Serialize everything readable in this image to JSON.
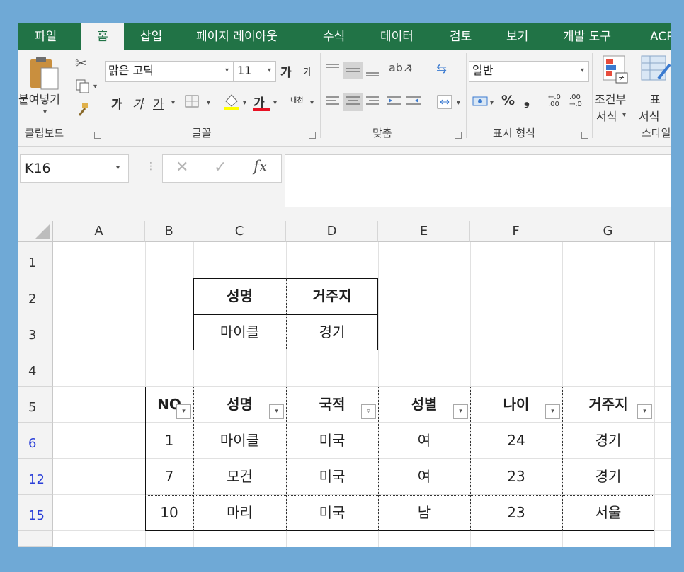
{
  "tabs": [
    "파일",
    "홈",
    "삽입",
    "페이지 레이아웃",
    "수식",
    "데이터",
    "검토",
    "보기",
    "개발 도구",
    "ACR"
  ],
  "ribbon": {
    "paste_label": "붙여넣기",
    "font_name": "맑은 고딕",
    "font_size": "11",
    "grow_font": "가",
    "shrink_font": "가",
    "bold": "가",
    "italic": "가",
    "underline": "가",
    "font_color_glyph": "가",
    "phonetic": "내천",
    "number_format": "일반",
    "percent": "%",
    "comma": "❟",
    "cond_format_label_1": "조건부",
    "cond_format_label_2": "서식",
    "table_format_label_1": "표",
    "table_format_label_2": "서식",
    "groups": {
      "clipboard": "클립보드",
      "font": "글꼴",
      "alignment": "맞춤",
      "number": "표시 형식",
      "styles": "스타일"
    }
  },
  "formula_bar": {
    "name_box": "K16",
    "fx": "fx",
    "formula": ""
  },
  "columns": [
    "A",
    "B",
    "C",
    "D",
    "E",
    "F",
    "G"
  ],
  "rows": [
    "1",
    "2",
    "3",
    "4",
    "5",
    "6",
    "12",
    "15"
  ],
  "criteria_table": {
    "headers": [
      "성명",
      "거주지"
    ],
    "values": [
      "마이클",
      "경기"
    ]
  },
  "data_table": {
    "headers": [
      "NO",
      "성명",
      "국적",
      "성별",
      "나이",
      "거주지"
    ],
    "rows": [
      [
        "1",
        "마이클",
        "미국",
        "여",
        "24",
        "경기"
      ],
      [
        "7",
        "모건",
        "미국",
        "여",
        "23",
        "경기"
      ],
      [
        "10",
        "마리",
        "미국",
        "남",
        "23",
        "서울"
      ]
    ]
  }
}
